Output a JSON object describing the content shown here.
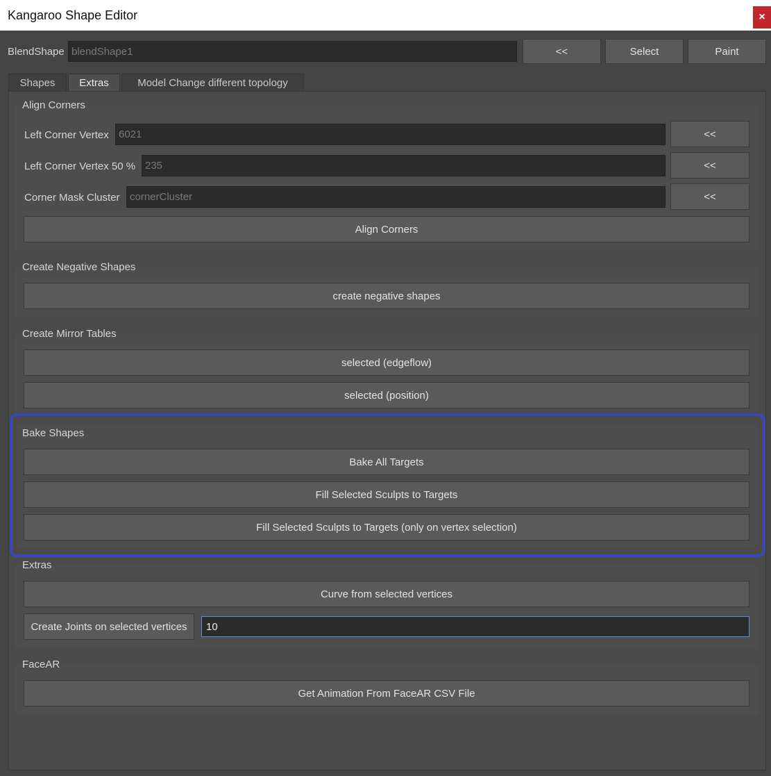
{
  "window": {
    "title": "Kangaroo Shape Editor",
    "close_glyph": "×"
  },
  "blendshape": {
    "label": "BlendShape",
    "value": "blendShape1",
    "pick_label": "<<",
    "select_label": "Select",
    "paint_label": "Paint"
  },
  "tabs": [
    {
      "label": "Shapes",
      "active": false
    },
    {
      "label": "Extras",
      "active": true
    },
    {
      "label": "Model Change different topology",
      "active": false
    }
  ],
  "align_corners": {
    "title": "Align Corners",
    "left_corner_label": "Left Corner Vertex",
    "left_corner_value": "6021",
    "left_corner_50_label": "Left Corner Vertex 50 %",
    "left_corner_50_value": "235",
    "mask_cluster_label": "Corner Mask Cluster",
    "mask_cluster_value": "cornerCluster",
    "pick_label": "<<",
    "button_label": "Align Corners"
  },
  "negative_shapes": {
    "title": "Create Negative Shapes",
    "button_label": "create negative shapes"
  },
  "mirror_tables": {
    "title": "Create Mirror Tables",
    "edgeflow_label": "selected (edgeflow)",
    "position_label": "selected (position)"
  },
  "bake_shapes": {
    "title": "Bake Shapes",
    "bake_all_label": "Bake All Targets",
    "fill_sculpts_label": "Fill Selected Sculpts to Targets",
    "fill_sculpts_vertex_label": "Fill Selected Sculpts to Targets (only on vertex selection)",
    "highlight_color": "#3848b8"
  },
  "extras": {
    "title": "Extras",
    "curve_label": "Curve from selected vertices",
    "joints_label": "Create Joints on selected vertices",
    "joints_value": "10"
  },
  "facear": {
    "title": "FaceAR",
    "button_label": "Get Animation From FaceAR CSV File"
  }
}
